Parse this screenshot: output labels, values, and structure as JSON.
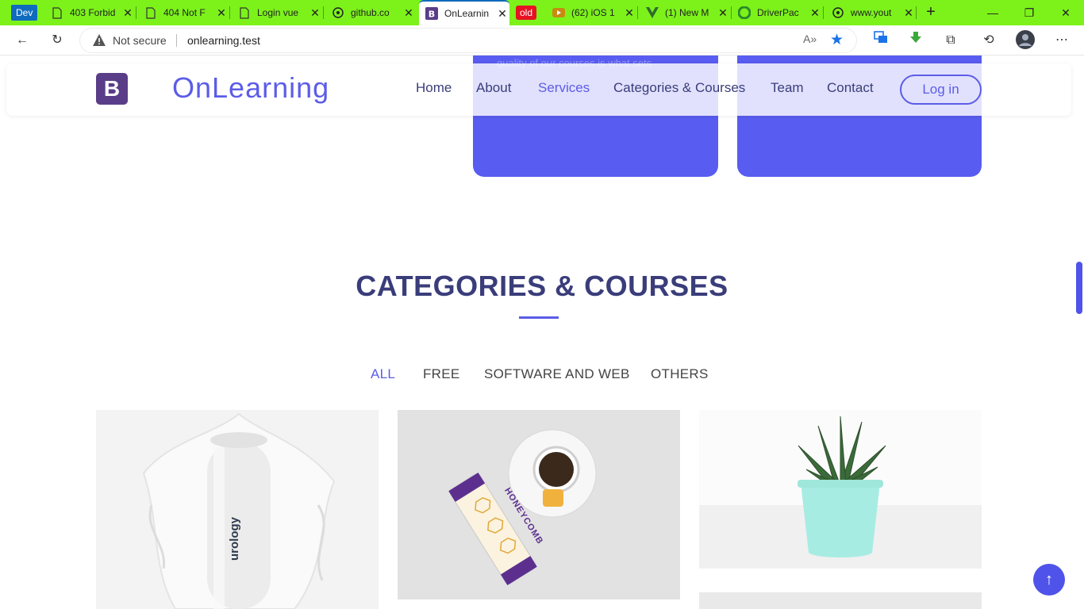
{
  "browser": {
    "dev_badge": "Dev",
    "tabs": [
      {
        "title": "403 Forbid",
        "icon": "page-icon"
      },
      {
        "title": "404 Not F",
        "icon": "page-icon"
      },
      {
        "title": "Login vue",
        "icon": "page-icon"
      },
      {
        "title": "github.co",
        "icon": "github-icon"
      },
      {
        "title": "OnLearnin",
        "icon": "bootstrap-icon",
        "active": true
      },
      {
        "title": "old",
        "icon": "tab-group-label"
      },
      {
        "title": "(62) iOS 1",
        "icon": "youtube-icon"
      },
      {
        "title": "(1) New M",
        "icon": "vue-icon"
      },
      {
        "title": "DriverPac",
        "icon": "driverpack-icon"
      },
      {
        "title": "www.yout",
        "icon": "github-icon"
      }
    ],
    "address": {
      "security_label": "Not secure",
      "url": "onlearning.test"
    }
  },
  "site": {
    "brand_letter": "B",
    "brand_name": "OnLearning",
    "nav": [
      "Home",
      "About",
      "Services",
      "Categories & Courses",
      "Team",
      "Contact"
    ],
    "active_nav": "Services",
    "login_label": "Log in",
    "partial_card_text": "quality of our courses is what sets"
  },
  "section": {
    "title": "CATEGORIES & COURSES",
    "filters": [
      "ALL",
      "FREE",
      "SOFTWARE AND WEB",
      "OTHERS"
    ],
    "active_filter": "ALL",
    "product_text": "urology",
    "honey_text": "HONEYCOMB"
  },
  "colors": {
    "accent": "#5c5ce8",
    "heading": "#3a3d7a",
    "tab_strip": "#7cf21a",
    "brand_logo": "#5a3d88"
  }
}
